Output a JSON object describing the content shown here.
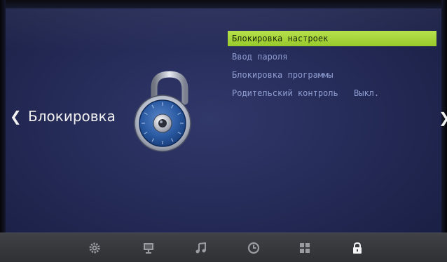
{
  "screen": {
    "title": "Блокировка",
    "nav_left_glyph": "❮",
    "nav_right_glyph": "❯"
  },
  "menu": {
    "items": [
      {
        "label": "Блокировка настроек",
        "value": "",
        "selected": true
      },
      {
        "label": "Ввод пароля",
        "value": "",
        "selected": false
      },
      {
        "label": "Блокировка программы",
        "value": "",
        "selected": false
      },
      {
        "label": "Родительский контроль",
        "value": "Выкл.",
        "selected": false
      }
    ]
  },
  "bottom_bar": {
    "icons": [
      "gear-icon",
      "monitor-icon",
      "music-note-icon",
      "clock-icon",
      "grid-icon",
      "lock-icon"
    ],
    "active": "lock-icon"
  },
  "colors": {
    "background": "#272d5a",
    "menu_text": "#8d9cd0",
    "selected_bar": "#a8d63c",
    "title_text": "#f2f2f2"
  }
}
